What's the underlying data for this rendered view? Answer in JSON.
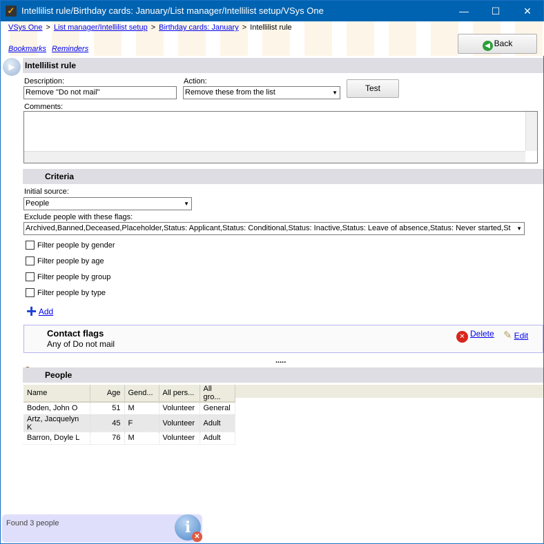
{
  "window": {
    "title": "Intellilist rule/Birthday cards: January/List manager/Intellilist setup/VSys One",
    "minimize": "—",
    "maximize": "☐",
    "close": "✕"
  },
  "breadcrumb": [
    {
      "label": "VSys One"
    },
    {
      "label": "List manager/Intellilist setup"
    },
    {
      "label": "Birthday cards: January"
    },
    {
      "label": "Intellilist rule"
    }
  ],
  "breadcrumb_sep": ">",
  "links": {
    "bookmarks": "Bookmarks",
    "reminders": "Reminders"
  },
  "back_label": "Back",
  "rule": {
    "section_title": "Intellilist rule",
    "description_label": "Description:",
    "description_value": "Remove \"Do not mail\"",
    "action_label": "Action:",
    "action_value": "Remove these from the list",
    "test_label": "Test",
    "comments_label": "Comments:",
    "comments_value": ""
  },
  "criteria": {
    "section_title": "Criteria",
    "initial_source_label": "Initial source:",
    "initial_source_value": "People",
    "exclude_label": "Exclude people with these flags:",
    "exclude_value": "Archived,Banned,Deceased,Placeholder,Status: Applicant,Status: Conditional,Status: Inactive,Status: Leave of absence,Status: Never started,St",
    "filters": [
      "Filter people by gender",
      "Filter people by age",
      "Filter people by group",
      "Filter people by type"
    ],
    "add_label": "Add"
  },
  "contact_flags": {
    "title": "Contact flags",
    "detail": "Any of Do not mail",
    "delete_label": "Delete",
    "edit_label": "Edit"
  },
  "splitter": ".....",
  "people": {
    "section_title": "People",
    "columns": [
      "Name",
      "Age",
      "Gend...",
      "All pers...",
      "All gro..."
    ],
    "rows": [
      [
        "Boden, John O",
        "51",
        "M",
        "Volunteer",
        "General"
      ],
      [
        "Artz, Jacquelyn K",
        "45",
        "F",
        "Volunteer",
        "Adult"
      ],
      [
        "Barron, Doyle L",
        "76",
        "M",
        "Volunteer",
        "Adult"
      ]
    ]
  },
  "status": {
    "text": "Found 3 people"
  }
}
